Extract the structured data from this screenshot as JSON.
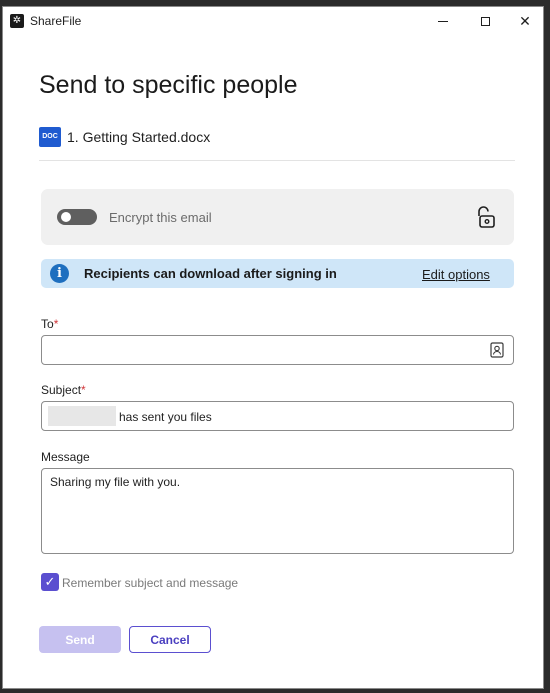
{
  "window": {
    "title": "ShareFile",
    "app_icon": "sharefile-logo-icon",
    "controls": [
      "minimize",
      "maximize",
      "close"
    ]
  },
  "dialog": {
    "heading": "Send to specific people",
    "file": {
      "badge": "DOC",
      "name": "1. Getting Started.docx"
    }
  },
  "encrypt": {
    "label": "Encrypt this email",
    "enabled": false,
    "icon": "unlock-icon"
  },
  "banner": {
    "text": "Recipients can download after signing in",
    "link": "Edit options",
    "icon": "info-icon"
  },
  "form": {
    "to": {
      "label": "To",
      "required_mark": "*",
      "value": "",
      "icon": "contacts-icon"
    },
    "subject": {
      "label": "Subject",
      "required_mark": "*",
      "value": "has sent you files"
    },
    "message": {
      "label": "Message",
      "value": "Sharing my file with you."
    },
    "remember": {
      "label": "Remember subject and message",
      "checked": true
    }
  },
  "actions": {
    "send": "Send",
    "cancel": "Cancel"
  },
  "colors": {
    "accent": "#5b4fd0",
    "accent_disabled": "#c6c1f0",
    "banner_bg": "#cfe6f8",
    "info": "#1e6fbf",
    "required": "#d13438",
    "doc_badge": "#1f5bd0"
  }
}
